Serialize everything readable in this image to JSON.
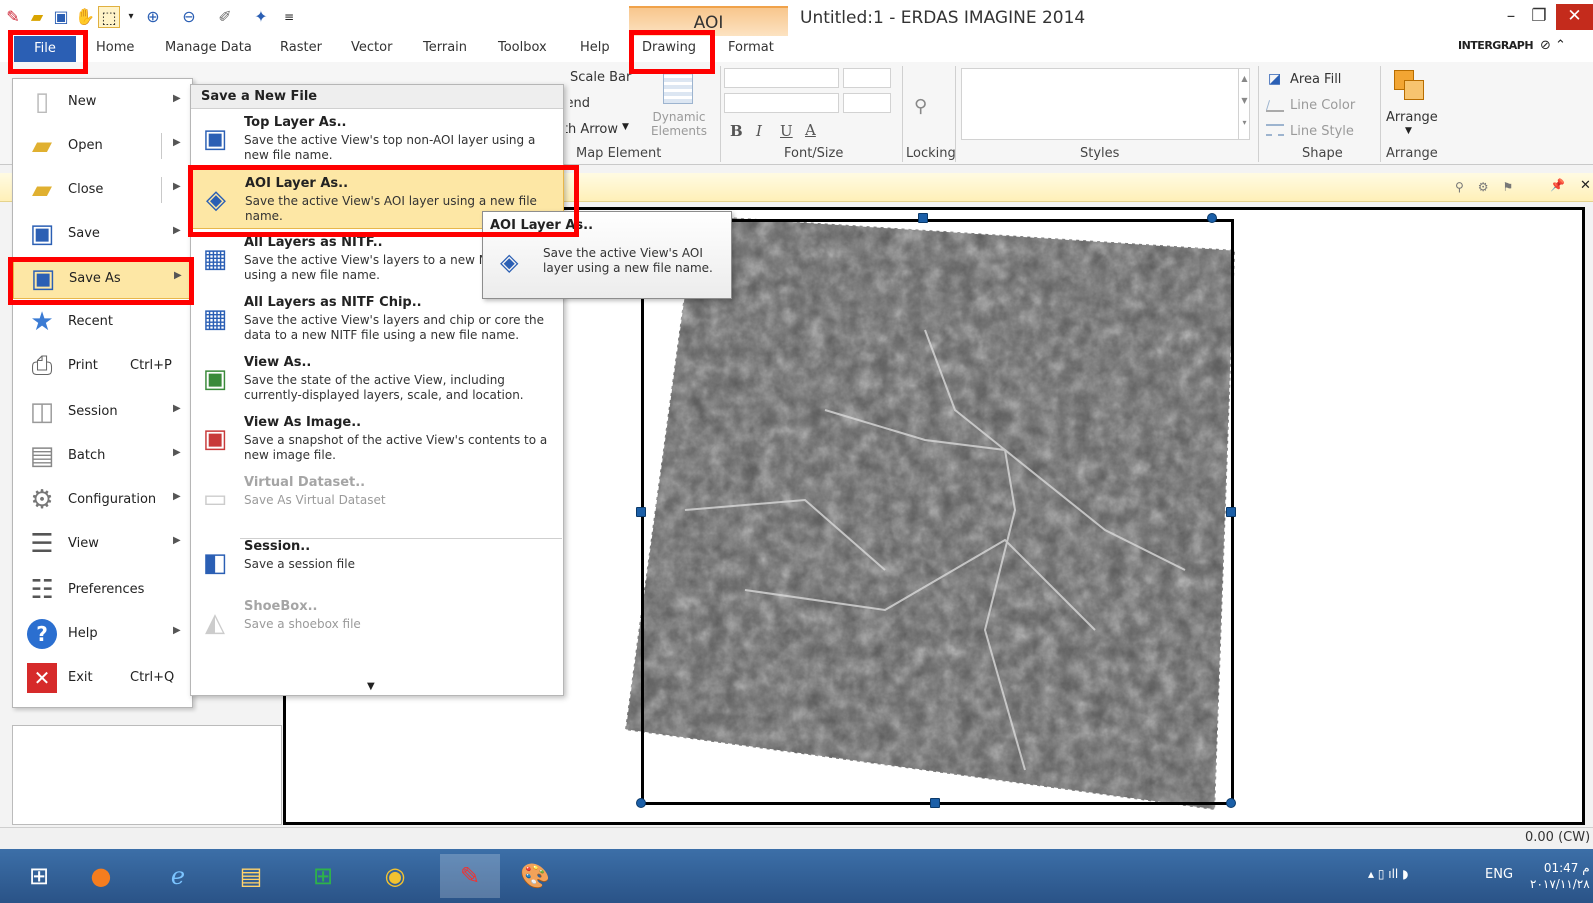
{
  "window": {
    "title": "Untitled:1 - ERDAS IMAGINE 2014",
    "context_tab_group": "AOI",
    "brand": "INTERGRAPH"
  },
  "ribbon_tabs": [
    "File",
    "Home",
    "Manage Data",
    "Raster",
    "Vector",
    "Terrain",
    "Toolbox",
    "Help",
    "Drawing",
    "Format"
  ],
  "ribbon": {
    "insert_items": [
      "Scale Bar",
      "Legend",
      "North Arrow"
    ],
    "dynamic_elements": "Dynamic Elements",
    "font_buttons": [
      "B",
      "I",
      "U",
      "A"
    ],
    "area_fill": "Area Fill",
    "line_color": "Line Color",
    "line_style": "Line Style",
    "arrange": "Arrange",
    "groups": [
      "Map Element",
      "Font/Size",
      "Locking",
      "Styles",
      "Shape",
      "Arrange"
    ]
  },
  "file_menu": {
    "items": [
      {
        "label": "New",
        "icon": "new-file-icon",
        "shortcut": "",
        "has_submenu": true,
        "split": false
      },
      {
        "label": "Open",
        "icon": "folder-open-icon",
        "shortcut": "",
        "has_submenu": true,
        "split": true
      },
      {
        "label": "Close",
        "icon": "folder-close-icon",
        "shortcut": "",
        "has_submenu": true,
        "split": true
      },
      {
        "label": "Save",
        "icon": "save-icon",
        "shortcut": "",
        "has_submenu": true,
        "split": false
      },
      {
        "label": "Save As",
        "icon": "save-as-icon",
        "shortcut": "",
        "has_submenu": true,
        "split": false,
        "highlighted": true
      },
      {
        "label": "Recent",
        "icon": "star-icon",
        "shortcut": "",
        "has_submenu": false,
        "split": false
      },
      {
        "label": "Print",
        "icon": "printer-icon",
        "shortcut": "Ctrl+P",
        "has_submenu": false,
        "split": false
      },
      {
        "label": "Session",
        "icon": "session-icon",
        "shortcut": "",
        "has_submenu": true,
        "split": false
      },
      {
        "label": "Batch",
        "icon": "batch-icon",
        "shortcut": "",
        "has_submenu": true,
        "split": false
      },
      {
        "label": "Configuration",
        "icon": "gears-icon",
        "shortcut": "",
        "has_submenu": true,
        "split": false
      },
      {
        "label": "View",
        "icon": "view-icon",
        "shortcut": "",
        "has_submenu": true,
        "split": false
      },
      {
        "label": "Preferences",
        "icon": "preferences-icon",
        "shortcut": "",
        "has_submenu": false,
        "split": false
      },
      {
        "label": "Help",
        "icon": "help-icon",
        "shortcut": "",
        "has_submenu": true,
        "split": false
      },
      {
        "label": "Exit",
        "icon": "exit-icon",
        "shortcut": "Ctrl+Q",
        "has_submenu": false,
        "split": false
      }
    ]
  },
  "save_submenu": {
    "header": "Save a New File",
    "items": [
      {
        "title": "Top Layer As..",
        "desc": "Save the active View's top non-AOI layer using a new file name.",
        "icon": "top-layer-icon",
        "enabled": true
      },
      {
        "title": "AOI Layer As..",
        "desc": "Save the active View's AOI layer using a new file name.",
        "icon": "aoi-layer-icon",
        "enabled": true,
        "highlighted": true
      },
      {
        "title": "All Layers as NITF..",
        "desc": "Save the active View's layers to a new NITF file using a new file name.",
        "icon": "nitf-icon",
        "enabled": true
      },
      {
        "title": "All Layers as NITF Chip..",
        "desc": "Save the active View's layers and chip or core the data to a new NITF file using a new file name.",
        "icon": "nitf-chip-icon",
        "enabled": true
      },
      {
        "title": "View As..",
        "desc": "Save the state of the active View, including currently-displayed layers, scale, and location.",
        "icon": "view-as-icon",
        "enabled": true
      },
      {
        "title": "View As Image..",
        "desc": "Save a snapshot of the active View's contents to a new image file.",
        "icon": "view-image-icon",
        "enabled": true
      },
      {
        "title": "Virtual Dataset..",
        "desc": "Save As Virtual Dataset",
        "icon": "virtual-dataset-icon",
        "enabled": false
      },
      {
        "title": "Session..",
        "desc": "Save a session file",
        "icon": "session-save-icon",
        "enabled": true
      },
      {
        "title": "ShoeBox..",
        "desc": "Save a shoebox file",
        "icon": "shoebox-icon",
        "enabled": false
      }
    ]
  },
  "tooltip": {
    "title": "AOI Layer As..",
    "text": "Save the active View's AOI layer using a new file name."
  },
  "status": {
    "scale": "0.00 (CW)"
  },
  "taskbar": {
    "apps": [
      "windows-start-icon",
      "firefox-icon",
      "internet-explorer-icon",
      "file-explorer-icon",
      "store-icon",
      "chrome-icon",
      "erdas-icon",
      "paint-icon"
    ],
    "lang": "ENG",
    "time": "01:47 م",
    "date": "٢٠١٧/١١/٢٨"
  },
  "colors": {
    "file_tab": "#2b5fb4",
    "highlight": "#fde7a5",
    "annotation_red": "#ff0000",
    "context_tab": "#f8c68d"
  }
}
